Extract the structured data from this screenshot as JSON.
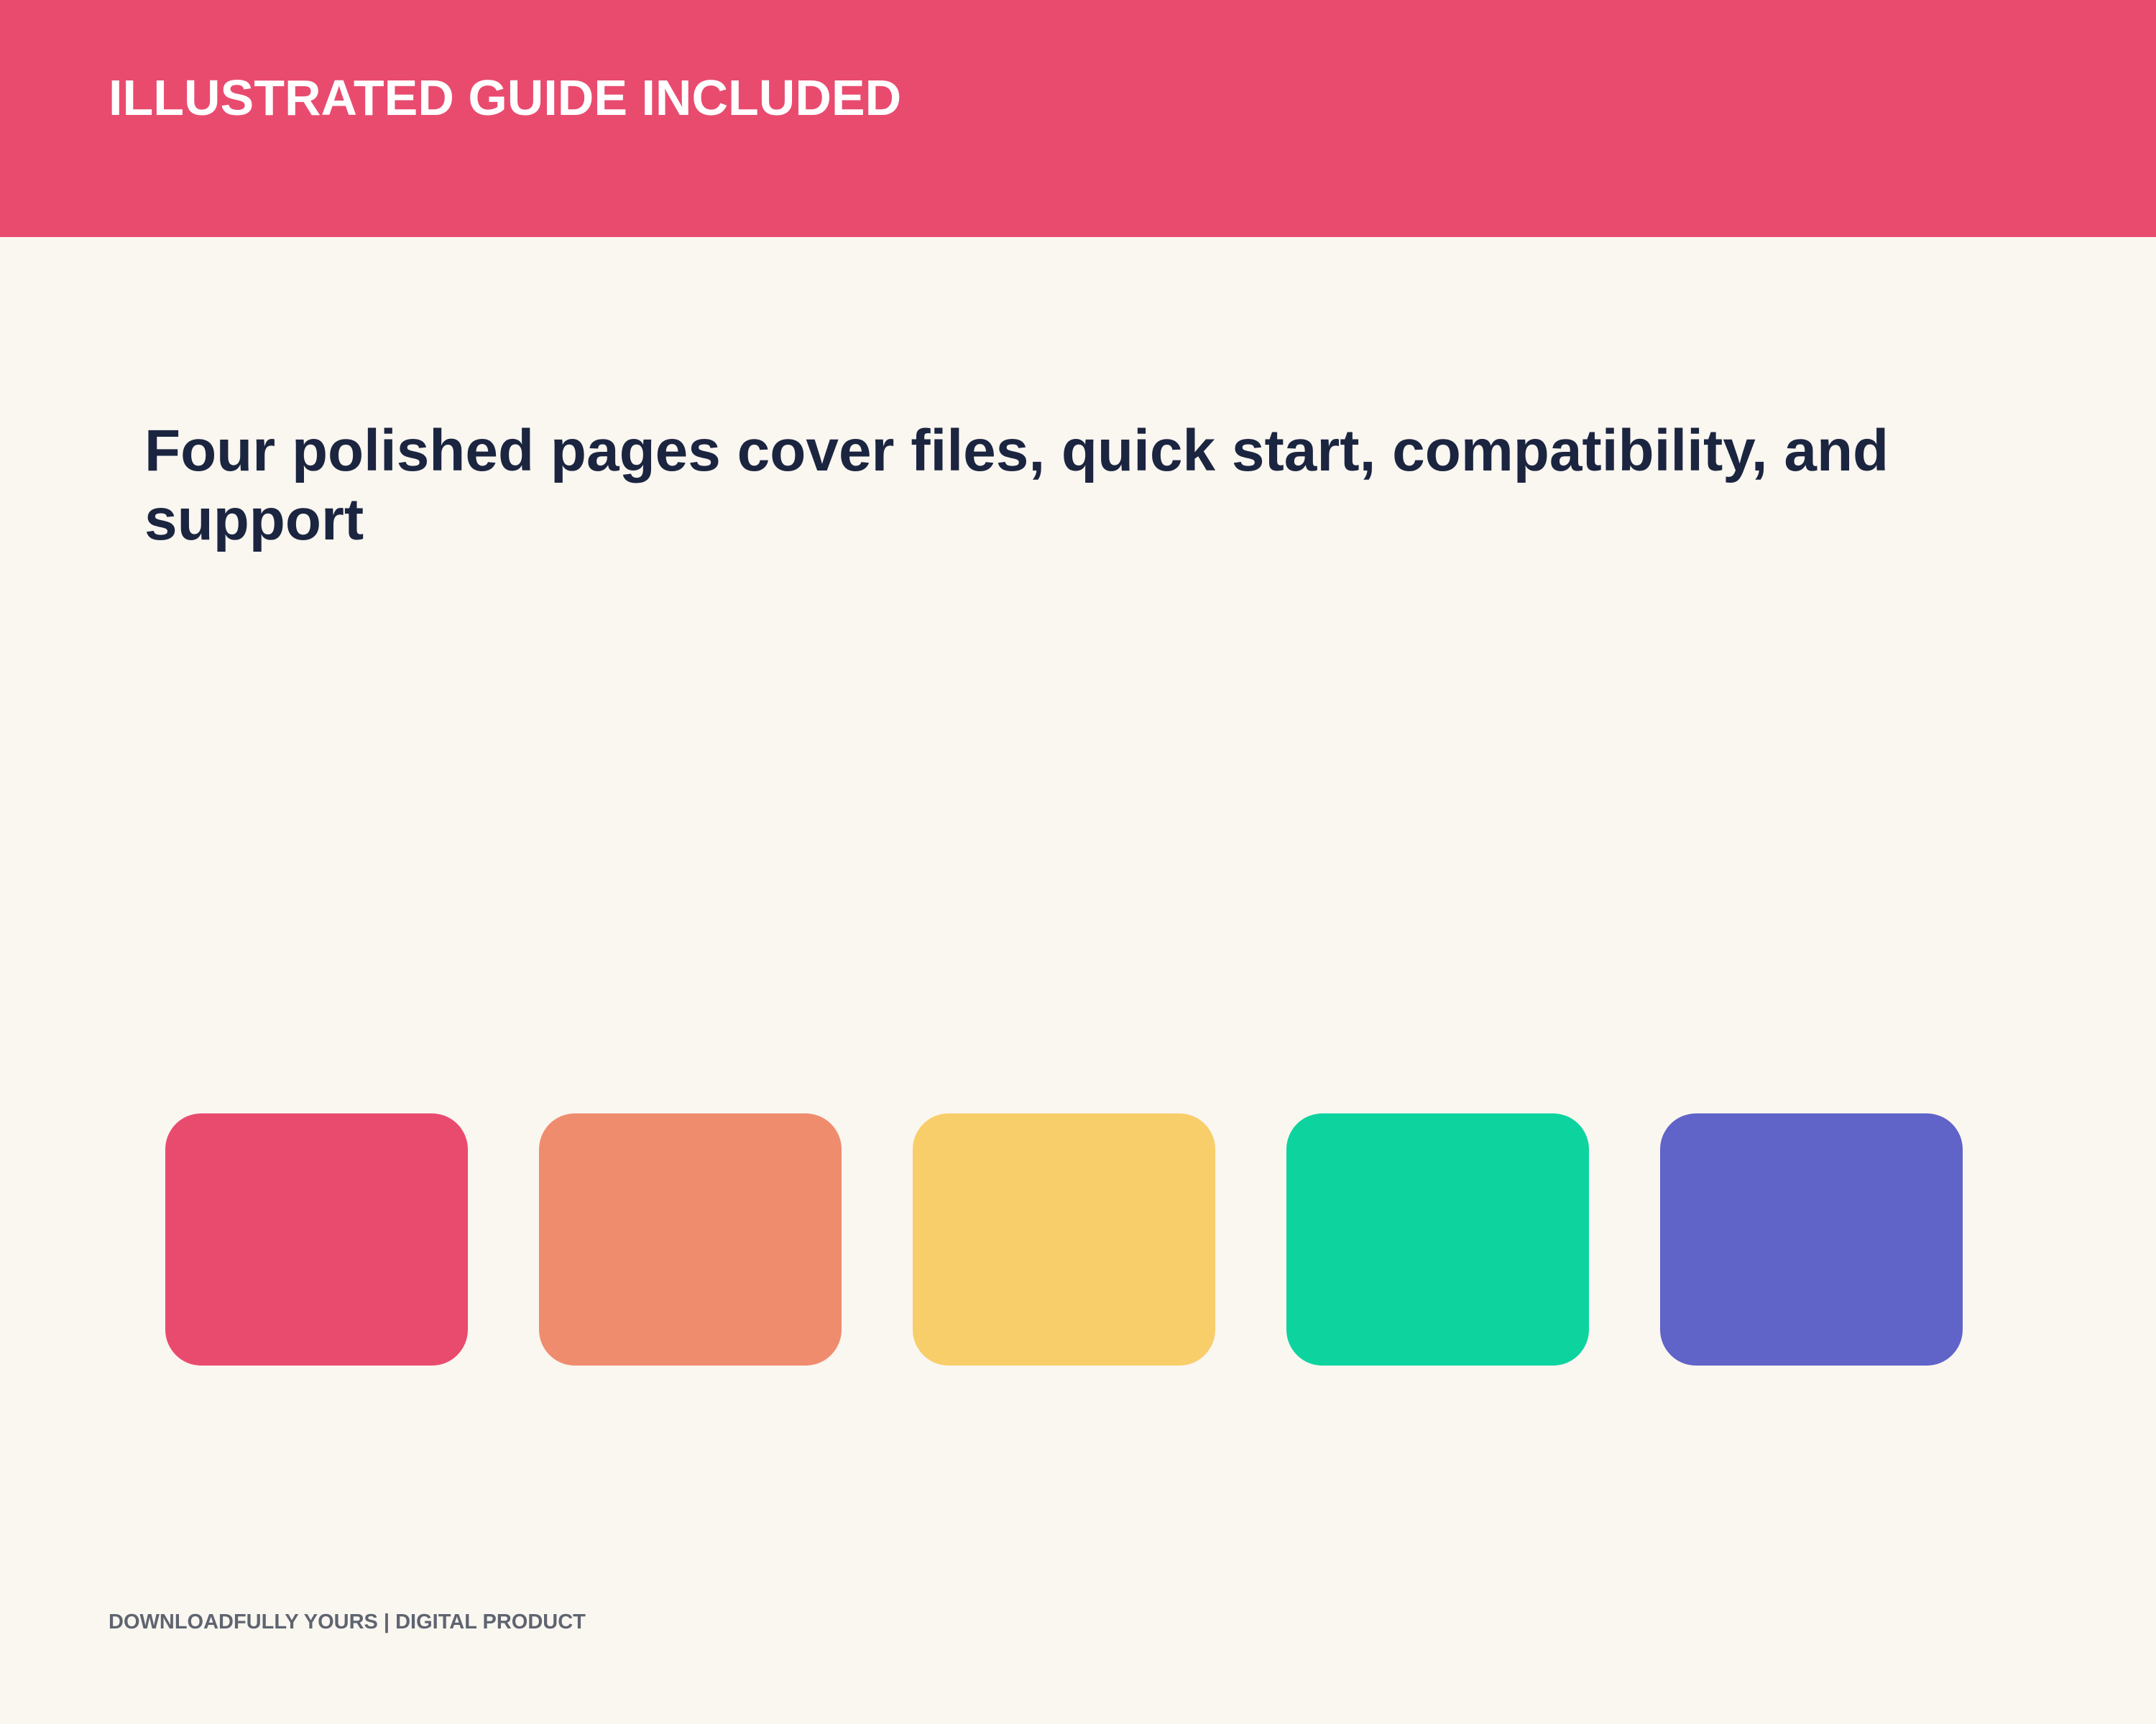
{
  "banner": {
    "title": "ILLUSTRATED GUIDE INCLUDED",
    "color": "#E94B6F"
  },
  "headline": "Four polished pages cover files, quick start, compatibility, and support",
  "swatches": [
    {
      "name": "rose",
      "color": "#E94B6F"
    },
    {
      "name": "coral",
      "color": "#F08C6E"
    },
    {
      "name": "yellow",
      "color": "#F8CE6A"
    },
    {
      "name": "green",
      "color": "#0DD39F"
    },
    {
      "name": "indigo",
      "color": "#6063C8"
    }
  ],
  "footer": "DOWNLOADFULLY YOURS | DIGITAL PRODUCT",
  "colors": {
    "background": "#FAF6F0",
    "headline_text": "#1B2540",
    "footer_text": "#5E6470"
  }
}
